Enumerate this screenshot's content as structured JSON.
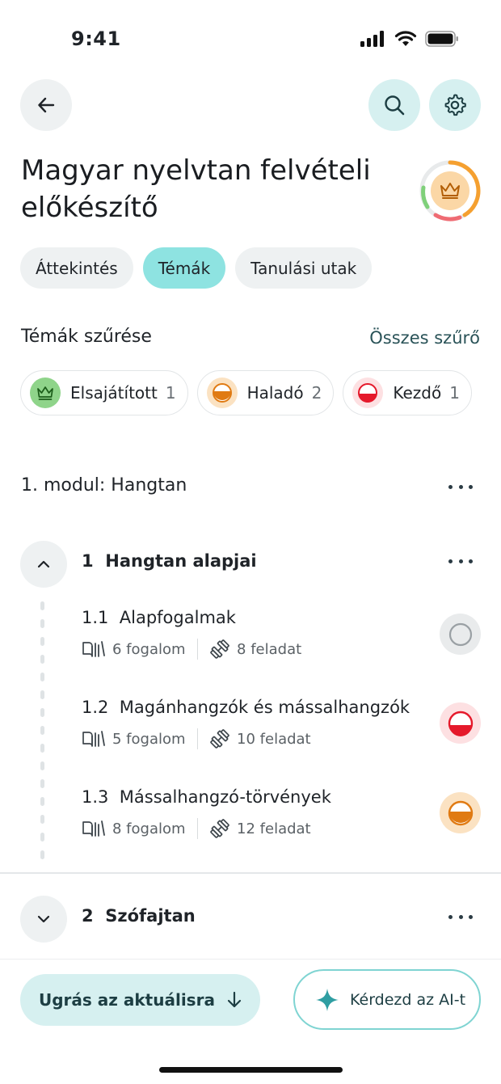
{
  "status_bar": {
    "time": "9:41"
  },
  "header": {
    "title": "Magyar nyelvtan felvételi előkészítő"
  },
  "tabs": [
    {
      "label": "Áttekintés",
      "active": false
    },
    {
      "label": "Témák",
      "active": true
    },
    {
      "label": "Tanulási utak",
      "active": false
    }
  ],
  "filters": {
    "title": "Témák szűrése",
    "all_label": "Összes szűrő",
    "chips": [
      {
        "label": "Elsajátított",
        "count": "1",
        "icon": "crown-icon",
        "color": "#8fd48a"
      },
      {
        "label": "Haladó",
        "count": "2",
        "icon": "half-circle-icon",
        "color": "#e07a12"
      },
      {
        "label": "Kezdő",
        "count": "1",
        "icon": "half-circle-icon",
        "color": "#e5192b"
      }
    ]
  },
  "module": {
    "title": "1. modul: Hangtan",
    "chapters": [
      {
        "number": "1",
        "title": "Hangtan alapjai",
        "expanded": true,
        "topics": [
          {
            "number": "1.1",
            "title": "Alapfogalmak",
            "concepts": "6 fogalom",
            "tasks": "8 feladat",
            "status": "not-started"
          },
          {
            "number": "1.2",
            "title": "Magánhangzók és mássalhangzók",
            "concepts": "5 fogalom",
            "tasks": "10 feladat",
            "status": "beginner"
          },
          {
            "number": "1.3",
            "title": "Mássalhangzó-törvények",
            "concepts": "8 fogalom",
            "tasks": "12 feladat",
            "status": "advanced"
          }
        ]
      },
      {
        "number": "2",
        "title": "Szófajtan",
        "expanded": false
      }
    ]
  },
  "bottom": {
    "jump_label": "Ugrás az aktuálisra",
    "ai_label": "Kérdezd az AI-t"
  },
  "colors": {
    "accent": "#8ee3e1",
    "accent_soft": "#d6f0f0",
    "mastered": "#8fd48a",
    "advanced": "#e07a12",
    "beginner": "#e5192b"
  }
}
